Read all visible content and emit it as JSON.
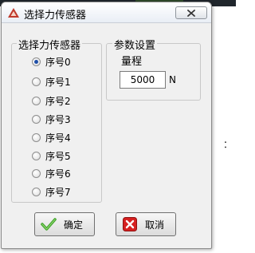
{
  "dialog": {
    "title": "选择力传感器"
  },
  "sensor_group": {
    "legend": "选择力传感器",
    "options": [
      {
        "label": "序号0",
        "checked": true
      },
      {
        "label": "序号1",
        "checked": false
      },
      {
        "label": "序号2",
        "checked": false
      },
      {
        "label": "序号3",
        "checked": false
      },
      {
        "label": "序号4",
        "checked": false
      },
      {
        "label": "序号5",
        "checked": false
      },
      {
        "label": "序号6",
        "checked": false
      },
      {
        "label": "序号7",
        "checked": false
      }
    ]
  },
  "params_group": {
    "legend": "参数设置",
    "range_label": "量程",
    "range_value": "5000",
    "unit": "N"
  },
  "buttons": {
    "ok_label": "确定",
    "cancel_label": "取消"
  },
  "background": {
    "right_char": "："
  },
  "colors": {
    "ok_icon": "#3fa32a",
    "cancel_icon": "#d62020",
    "title_icon": "#c0392b"
  }
}
